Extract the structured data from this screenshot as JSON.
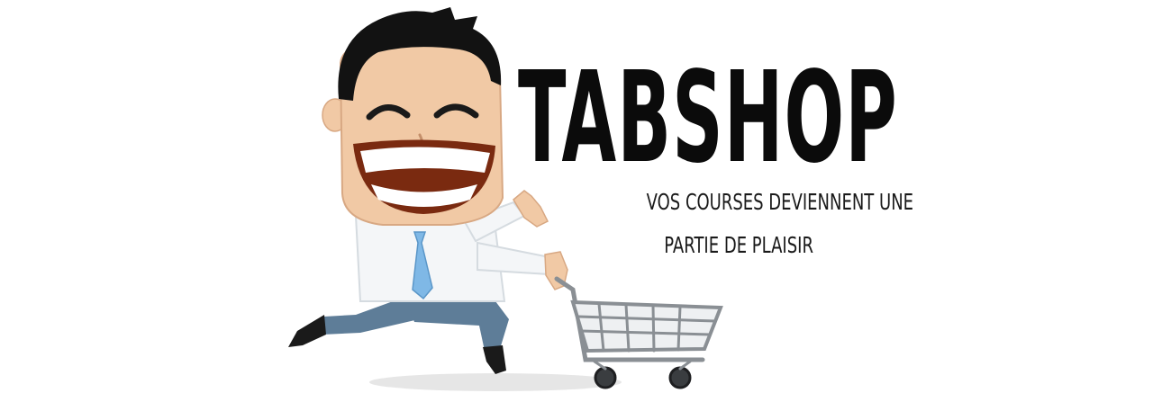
{
  "brand": {
    "title": "TABSHOP",
    "tagline_line1": "VOS COURSES DEVIENNENT UNE",
    "tagline_line2": "PARTIE DE PLAISIR"
  },
  "illustration": {
    "subject": "cartoon businessman running with shopping cart",
    "icon": "shopping-cart-icon"
  },
  "colors": {
    "text": "#0b0b0b",
    "background": "#ffffff",
    "tie": "#7fb8e6",
    "pants": "#5a7a95",
    "cart": "#8a8f94"
  }
}
